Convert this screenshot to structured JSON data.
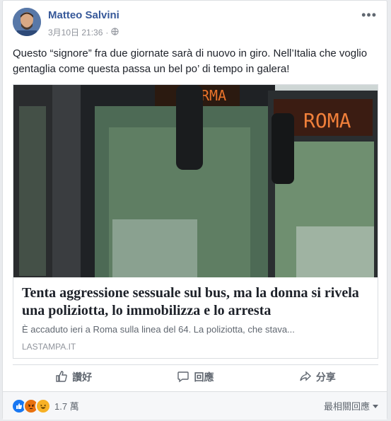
{
  "post": {
    "author": "Matteo Salvini",
    "timestamp": "3月10日 21:36",
    "separator": "·",
    "text": "Questo “signore” fra due giornate sarà di nuovo in giro. Nell’Italia che voglio gentaglia come questa passa un bel po’ di tempo in galera!"
  },
  "link": {
    "title": "Tenta aggressione sessuale sul bus, ma la donna si rivela una poliziotta, lo immobilizza e lo arresta",
    "description": "È accaduto ieri a Roma sulla linea del 64. La poliziotta, che stava...",
    "domain": "LASTAMPA.IT",
    "image_sign_text": "ROMA"
  },
  "actions": {
    "like": "讚好",
    "comment": "回應",
    "share": "分享"
  },
  "reactions": {
    "count": "1.7 萬",
    "sort_label": "最相關回應"
  },
  "colors": {
    "author_link": "#365899",
    "like_blue": "#1877f2",
    "angry": "#e9710f",
    "haha": "#f7b125"
  }
}
